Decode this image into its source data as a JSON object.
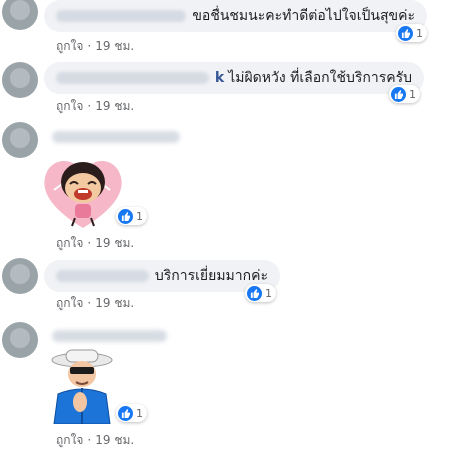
{
  "comments": [
    {
      "text": "ขอชื่นชมนะคะทำดีต่อไปใจเป็นสุขค่ะ",
      "like_label": "ถูกใจ",
      "time": "19 ชม.",
      "reactions": "1"
    },
    {
      "text": "ไม่ผิดหวัง ที่เลือกใช้บริการครับ",
      "like_label": "ถูกใจ",
      "time": "19 ชม.",
      "reactions": "1"
    },
    {
      "sticker": "laughing-girl-heart-sticker",
      "like_label": "ถูกใจ",
      "time": "19 ชม.",
      "reactions": "1"
    },
    {
      "text": "บริการเยี่ยมมากค่ะ",
      "like_label": "ถูกใจ",
      "time": "19 ชม.",
      "reactions": "1"
    },
    {
      "sticker": "cool-grandpa-clapping-sticker",
      "like_label": "ถูกใจ",
      "time": "19 ชม.",
      "reactions": "1"
    }
  ],
  "icons": {
    "reaction": "like-thumb-icon",
    "avatar": "avatar"
  },
  "colors": {
    "reaction_blue": "#1877f2",
    "bubble": "#f0f2f5",
    "meta_text": "#65676b"
  }
}
